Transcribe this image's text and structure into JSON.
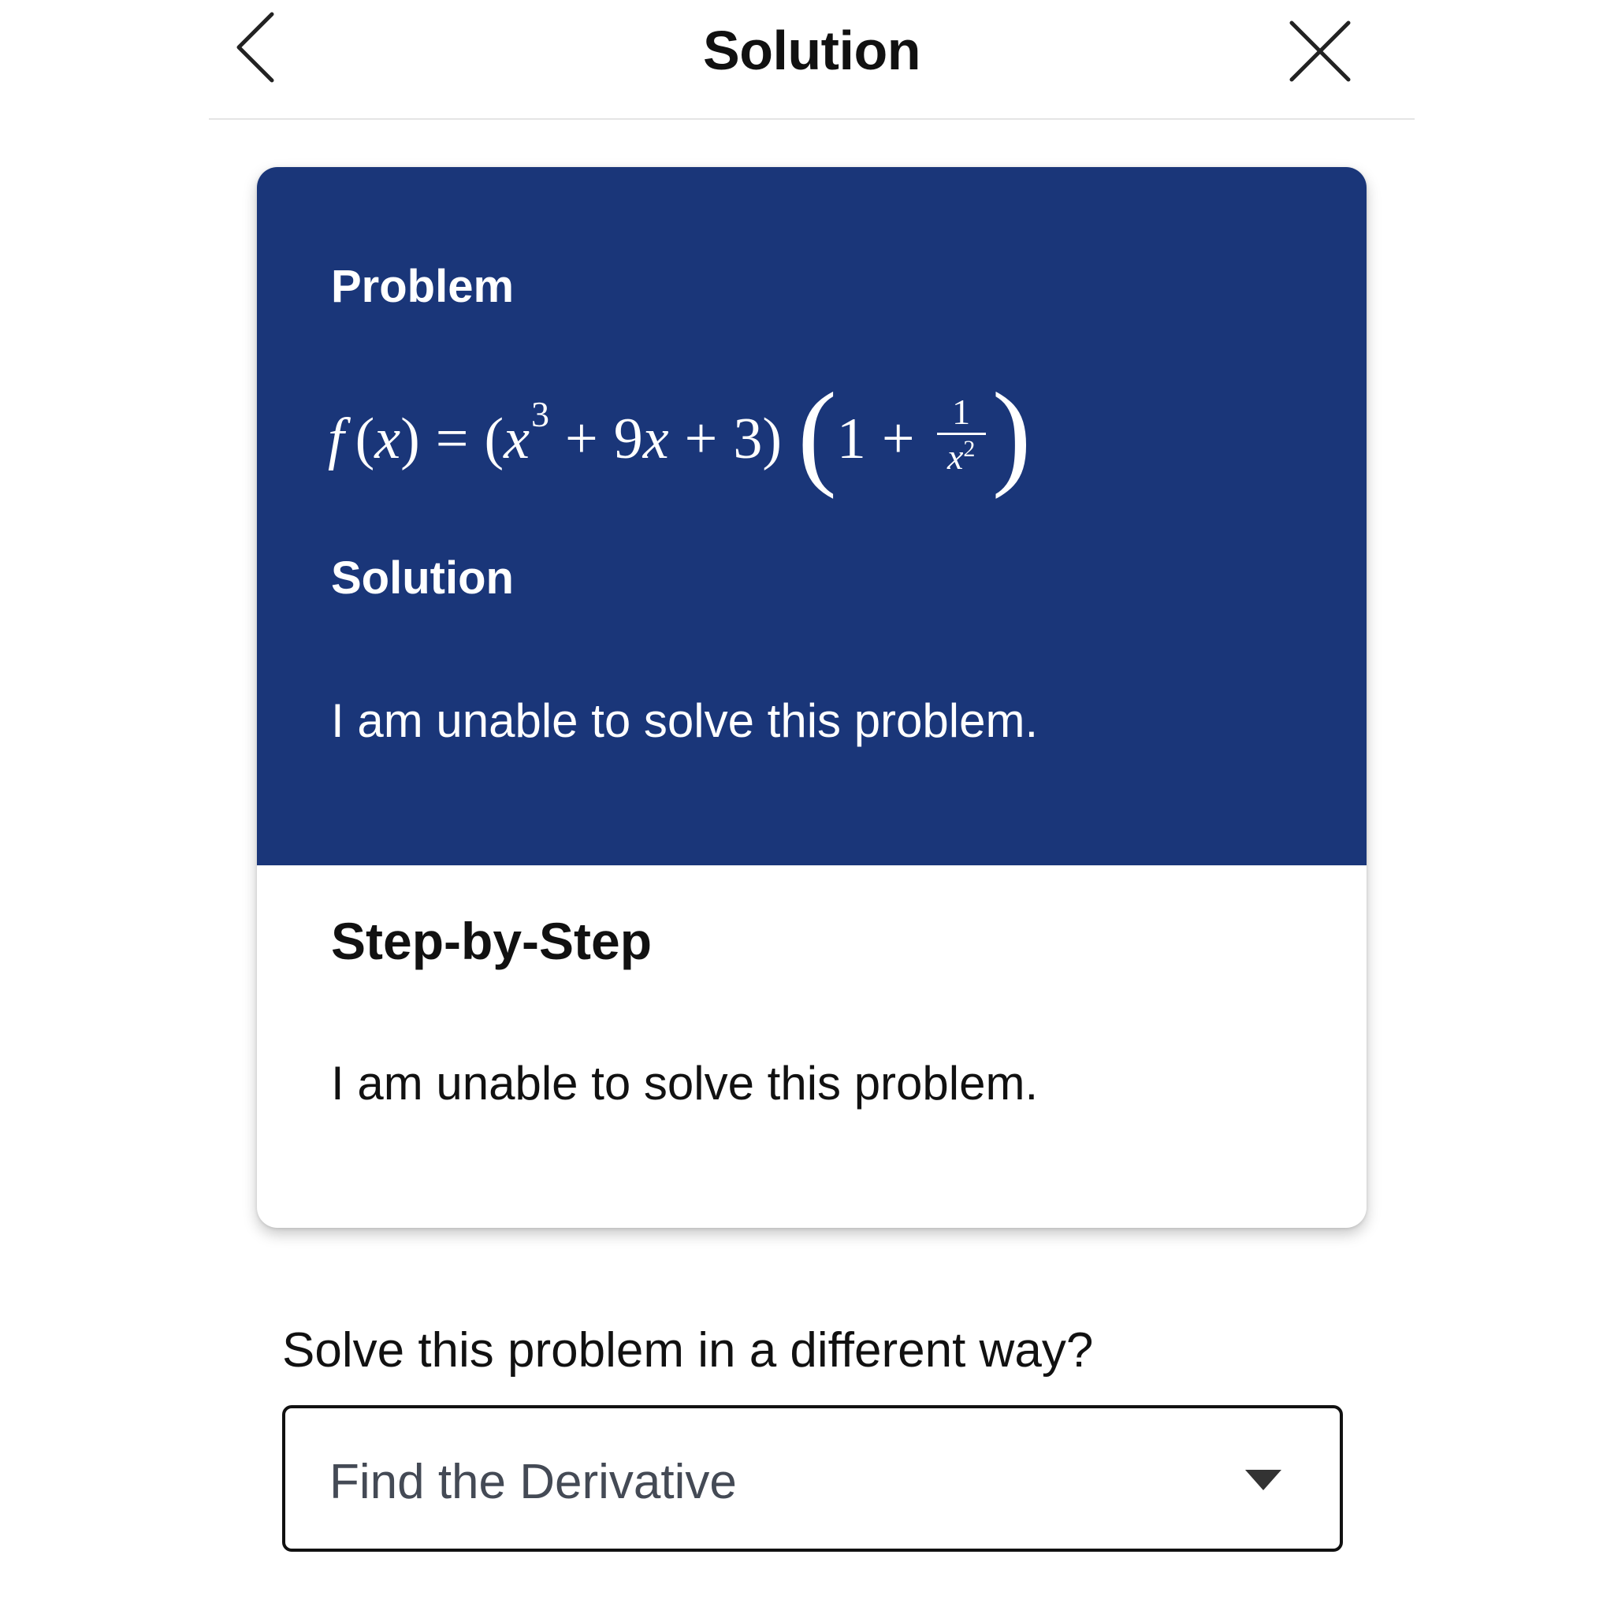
{
  "header": {
    "title": "Solution",
    "back_icon": "chevron-left-icon",
    "close_icon": "close-icon"
  },
  "card": {
    "problem_label": "Problem",
    "formula": {
      "lhs_f": "f",
      "lhs_open": "(",
      "lhs_x": "x",
      "lhs_close": ")",
      "equals": "=",
      "p1_open": "(",
      "term1_base": "x",
      "term1_exp": "3",
      "plus1": "+",
      "term2": "9",
      "term2_var": "x",
      "plus2": "+",
      "term3": "3",
      "p1_close": ")",
      "p2_open": "(",
      "one": "1",
      "plus3": "+",
      "frac_num": "1",
      "frac_den_base": "x",
      "frac_den_exp": "2",
      "p2_close": ")"
    },
    "solution_label": "Solution",
    "solution_text": "I am unable to solve this problem.",
    "step_title": "Step-by-Step",
    "step_text": "I am unable to solve this problem."
  },
  "alternate": {
    "question": "Solve this problem in a different way?",
    "selected_option": "Find the Derivative",
    "arrow_icon": "caret-down-icon"
  },
  "colors": {
    "card_top": "#1a3679",
    "text_dark": "#111111",
    "dropdown_text": "#444a55"
  }
}
